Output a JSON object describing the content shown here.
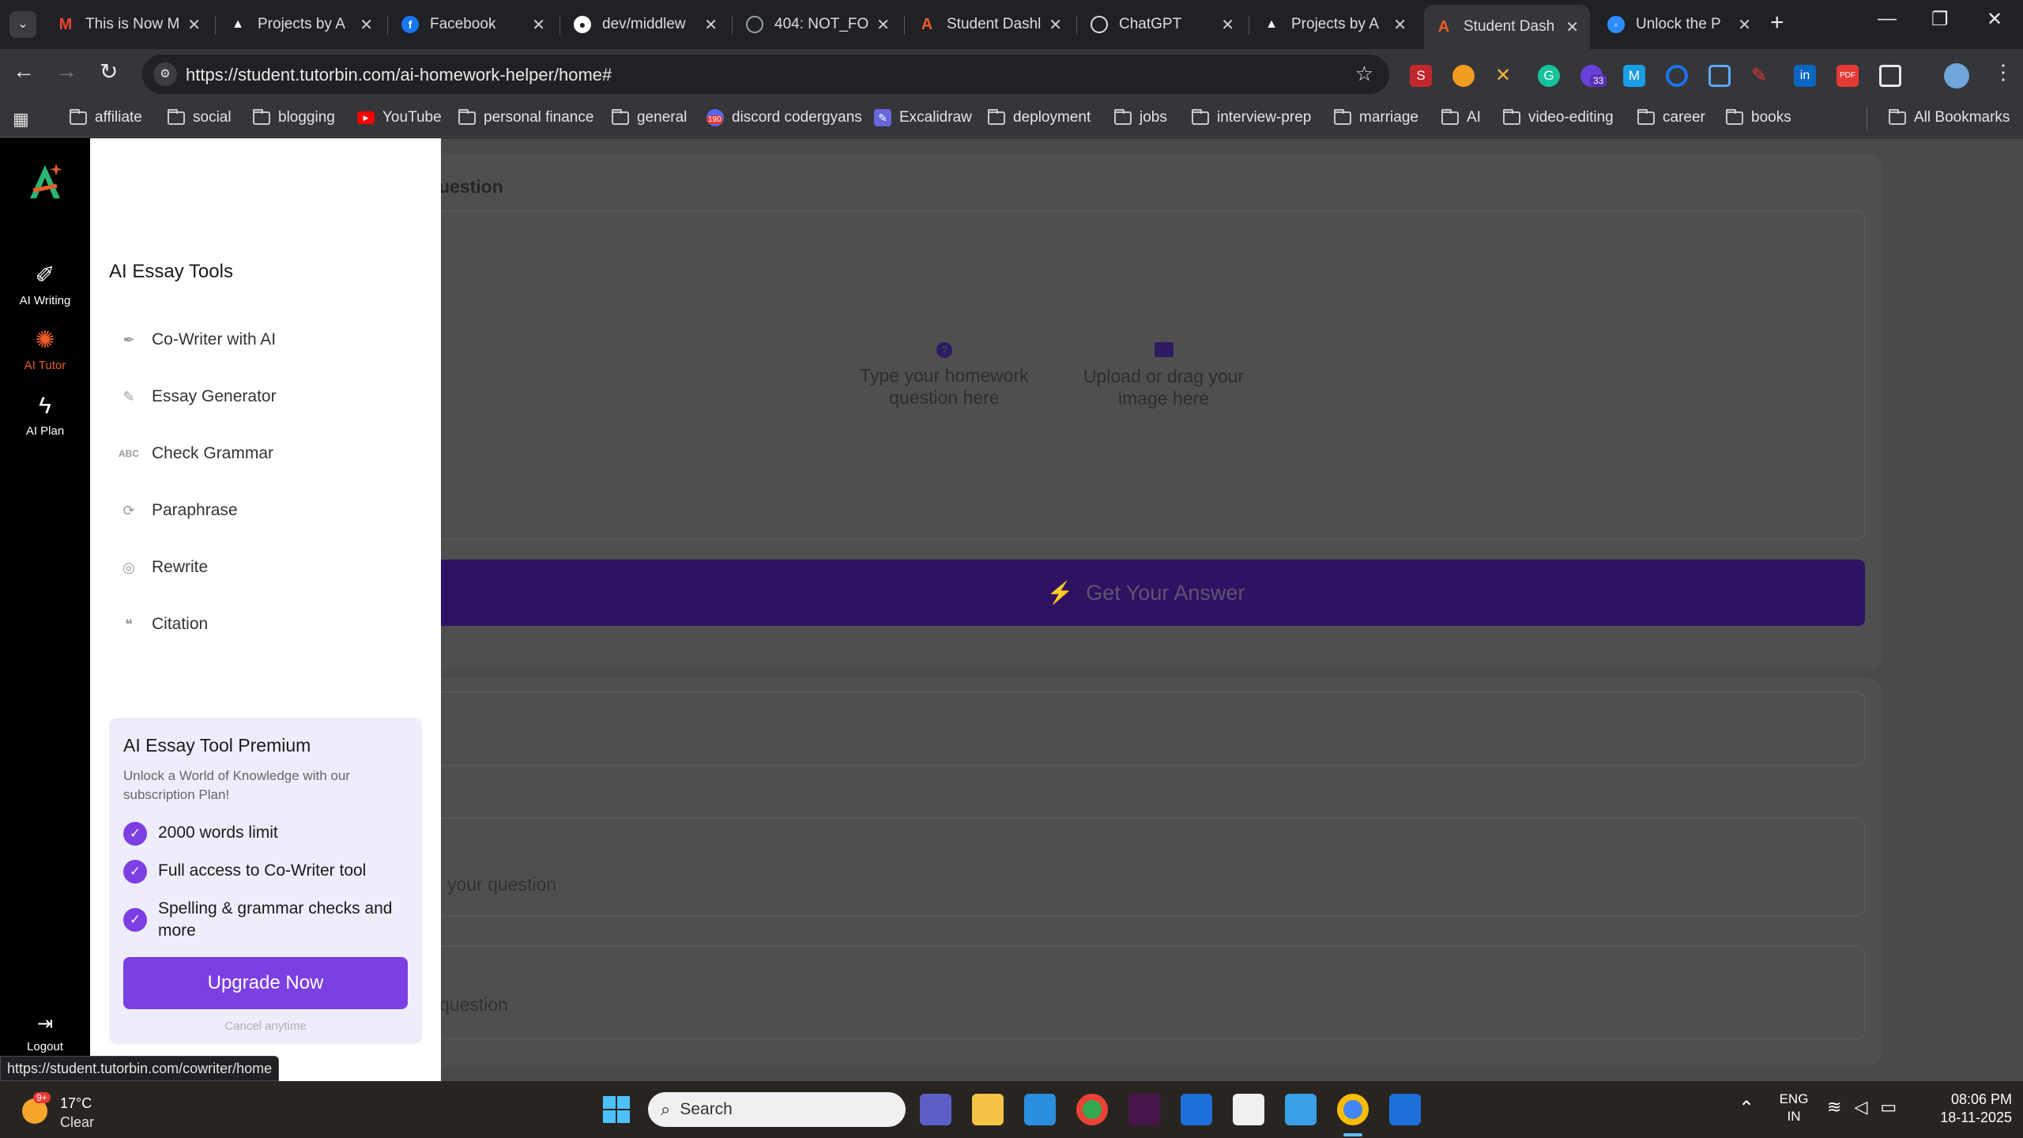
{
  "browser": {
    "tabs": [
      {
        "title": "This is Now M",
        "icon": "gmail-icon",
        "color": "#ea4335"
      },
      {
        "title": "Projects by A",
        "icon": "triangle-icon",
        "color": "#ffffff"
      },
      {
        "title": "Facebook",
        "icon": "facebook-icon",
        "color": "#1877f2"
      },
      {
        "title": "dev/middlew",
        "icon": "github-icon",
        "color": "#ffffff"
      },
      {
        "title": "404: NOT_FO",
        "icon": "globe-icon",
        "color": "#9aa0a6"
      },
      {
        "title": "Student Dashl",
        "icon": "tutorbin-icon",
        "color": "#e85d2a"
      },
      {
        "title": "ChatGPT",
        "icon": "chatgpt-icon",
        "color": "#ffffff"
      },
      {
        "title": "Projects by A",
        "icon": "triangle-icon",
        "color": "#ffffff"
      },
      {
        "title": "Student Dash",
        "icon": "tutorbin-icon",
        "color": "#e85d2a"
      },
      {
        "title": "Unlock the P",
        "icon": "chat-icon",
        "color": "#2d8cff"
      }
    ],
    "url": "https://student.tutorbin.com/ai-homework-helper/home#",
    "bookmarks": [
      {
        "label": "affiliate",
        "type": "folder"
      },
      {
        "label": "social",
        "type": "folder"
      },
      {
        "label": "blogging",
        "type": "folder"
      },
      {
        "label": "YouTube",
        "type": "youtube"
      },
      {
        "label": "personal finance",
        "type": "folder"
      },
      {
        "label": "general",
        "type": "folder"
      },
      {
        "label": "discord codergyans",
        "type": "discord"
      },
      {
        "label": "Excalidraw",
        "type": "excalidraw"
      },
      {
        "label": "deployment",
        "type": "folder"
      },
      {
        "label": "jobs",
        "type": "folder"
      },
      {
        "label": "interview-prep",
        "type": "folder"
      },
      {
        "label": "marriage",
        "type": "folder"
      },
      {
        "label": "AI",
        "type": "folder"
      },
      {
        "label": "video-editing",
        "type": "folder"
      },
      {
        "label": "career",
        "type": "folder"
      },
      {
        "label": "books",
        "type": "folder"
      }
    ],
    "all_bookmarks": "All Bookmarks",
    "discord_badge": "190",
    "ext_badge": "33",
    "status_url": "https://student.tutorbin.com/cowriter/home"
  },
  "rail": {
    "items": [
      {
        "label": "AI Writing",
        "icon": "magic-wand-icon"
      },
      {
        "label": "AI Tutor",
        "icon": "openai-icon"
      },
      {
        "label": "AI Plan",
        "icon": "lightning-icon"
      }
    ],
    "logout": "Logout",
    "active_color": "#e85d2a"
  },
  "menu": {
    "title": "AI Essay Tools",
    "items": [
      {
        "label": "Co-Writer with AI",
        "icon": "feather-icon"
      },
      {
        "label": "Essay Generator",
        "icon": "document-edit-icon"
      },
      {
        "label": "Check Grammar",
        "icon": "abc-check-icon"
      },
      {
        "label": "Paraphrase",
        "icon": "refresh-icon"
      },
      {
        "label": "Rewrite",
        "icon": "rewrite-icon"
      },
      {
        "label": "Citation",
        "icon": "quote-icon"
      }
    ],
    "premium": {
      "title": "AI Essay Tool Premium",
      "subtitle": "Unlock a World of Knowledge with our subscription Plan!",
      "features": [
        "2000 words limit",
        "Full access to Co-Writer tool",
        "Spelling & grammar checks and more"
      ],
      "button": "Upgrade Now",
      "cancel": "Cancel anytime",
      "accent": "#7b3fe4"
    }
  },
  "main": {
    "question_title": "uestion",
    "type_prompt": "Type your homework question here",
    "upload_prompt": "Upload or drag your image here",
    "get_answer": "Get Your Answer",
    "field1_placeholder": "your question",
    "field2_placeholder": "question"
  },
  "taskbar": {
    "weather_temp": "17°C",
    "weather_cond": "Clear",
    "weather_badge": "9+",
    "search": "Search",
    "lang": "ENG",
    "region": "IN",
    "time": "08:06 PM",
    "date": "18-11-2025"
  }
}
